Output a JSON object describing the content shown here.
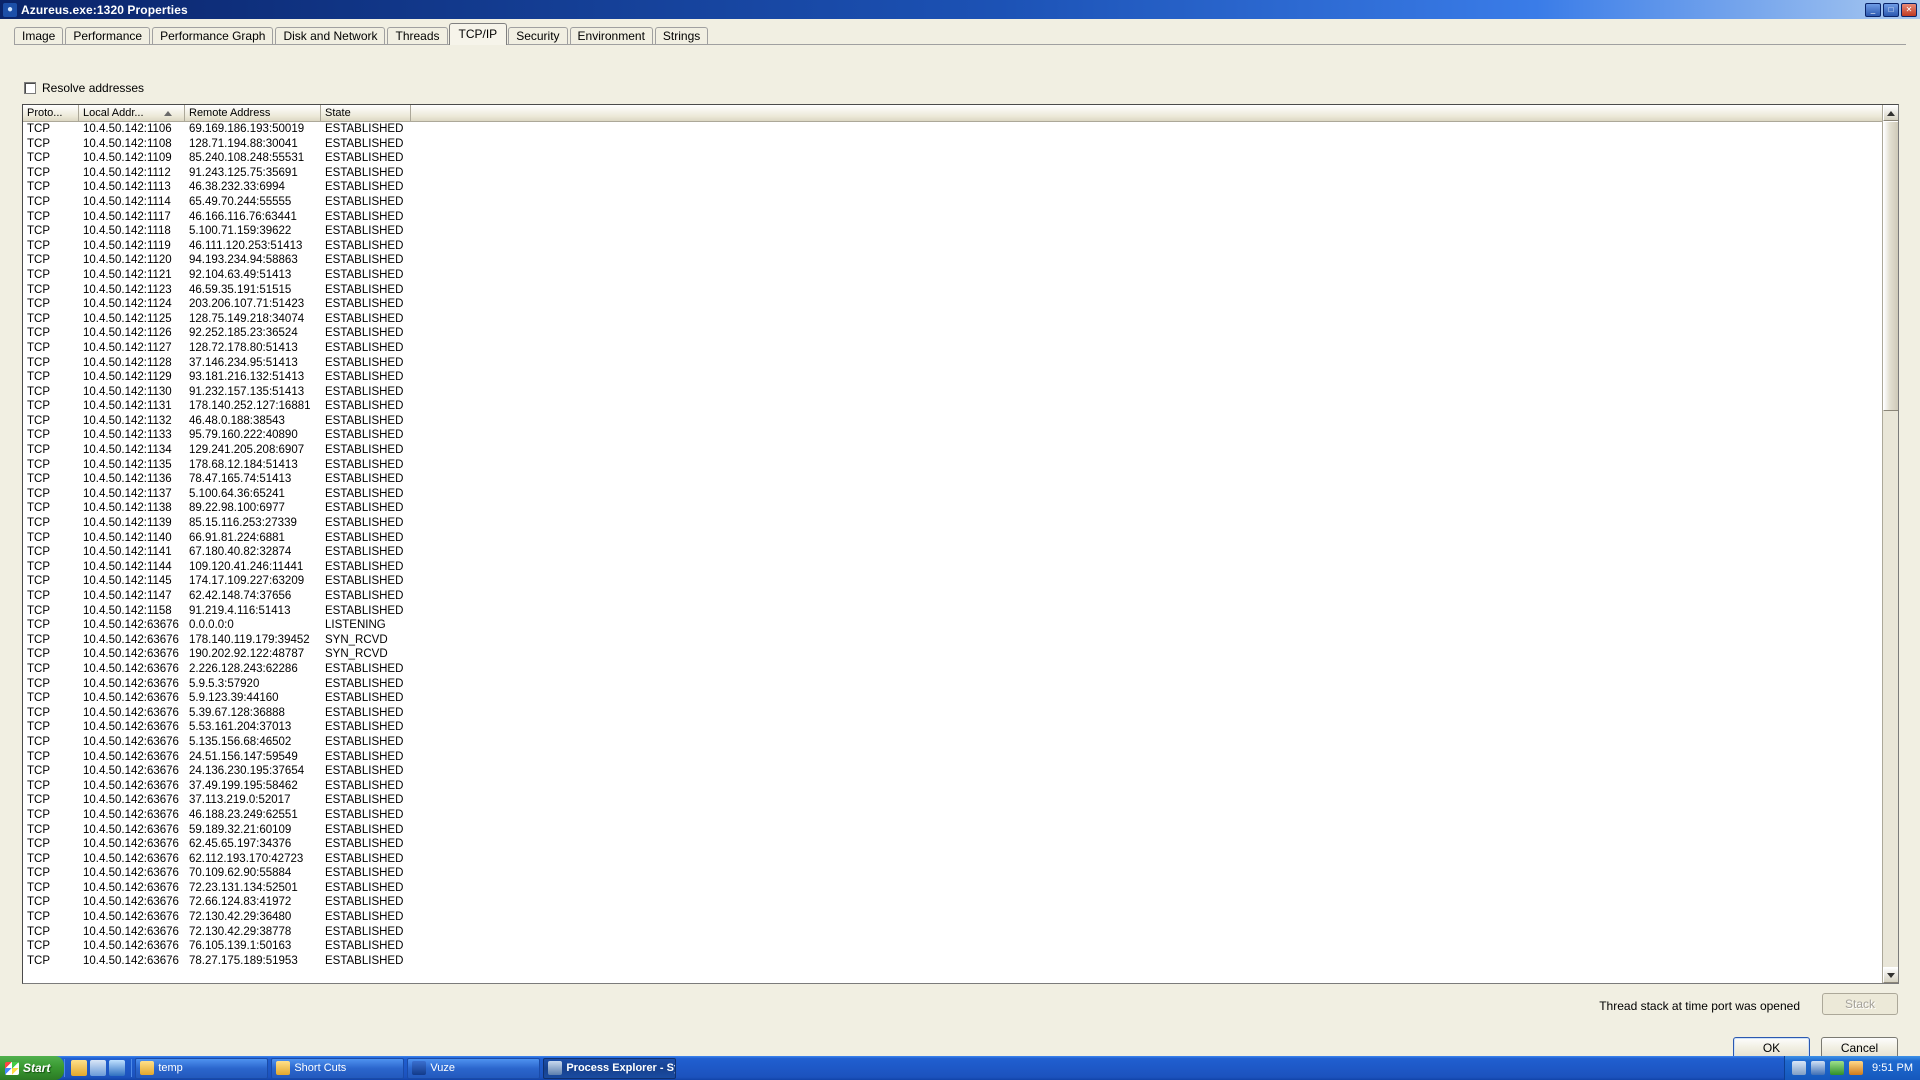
{
  "window": {
    "title": "Azureus.exe:1320 Properties",
    "icon": "azureus-icon",
    "buttons": {
      "minimize": "_",
      "maximize": "□",
      "close": "✕"
    }
  },
  "tabs": [
    {
      "label": "Image",
      "active": false
    },
    {
      "label": "Performance",
      "active": false
    },
    {
      "label": "Performance Graph",
      "active": false
    },
    {
      "label": "Disk and Network",
      "active": false
    },
    {
      "label": "Threads",
      "active": false
    },
    {
      "label": "TCP/IP",
      "active": true
    },
    {
      "label": "Security",
      "active": false
    },
    {
      "label": "Environment",
      "active": false
    },
    {
      "label": "Strings",
      "active": false
    }
  ],
  "options": {
    "resolve_addresses_label": "Resolve addresses",
    "resolve_addresses_checked": false
  },
  "table": {
    "columns": [
      {
        "label": "Proto...",
        "sorted": false
      },
      {
        "label": "Local Addr...",
        "sorted": true,
        "sort_direction": "asc"
      },
      {
        "label": "Remote Address",
        "sorted": false
      },
      {
        "label": "State",
        "sorted": false
      }
    ],
    "rows": [
      [
        "TCP",
        "10.4.50.142:1106",
        "69.169.186.193:50019",
        "ESTABLISHED"
      ],
      [
        "TCP",
        "10.4.50.142:1108",
        "128.71.194.88:30041",
        "ESTABLISHED"
      ],
      [
        "TCP",
        "10.4.50.142:1109",
        "85.240.108.248:55531",
        "ESTABLISHED"
      ],
      [
        "TCP",
        "10.4.50.142:1112",
        "91.243.125.75:35691",
        "ESTABLISHED"
      ],
      [
        "TCP",
        "10.4.50.142:1113",
        "46.38.232.33:6994",
        "ESTABLISHED"
      ],
      [
        "TCP",
        "10.4.50.142:1114",
        "65.49.70.244:55555",
        "ESTABLISHED"
      ],
      [
        "TCP",
        "10.4.50.142:1117",
        "46.166.116.76:63441",
        "ESTABLISHED"
      ],
      [
        "TCP",
        "10.4.50.142:1118",
        "5.100.71.159:39622",
        "ESTABLISHED"
      ],
      [
        "TCP",
        "10.4.50.142:1119",
        "46.111.120.253:51413",
        "ESTABLISHED"
      ],
      [
        "TCP",
        "10.4.50.142:1120",
        "94.193.234.94:58863",
        "ESTABLISHED"
      ],
      [
        "TCP",
        "10.4.50.142:1121",
        "92.104.63.49:51413",
        "ESTABLISHED"
      ],
      [
        "TCP",
        "10.4.50.142:1123",
        "46.59.35.191:51515",
        "ESTABLISHED"
      ],
      [
        "TCP",
        "10.4.50.142:1124",
        "203.206.107.71:51423",
        "ESTABLISHED"
      ],
      [
        "TCP",
        "10.4.50.142:1125",
        "128.75.149.218:34074",
        "ESTABLISHED"
      ],
      [
        "TCP",
        "10.4.50.142:1126",
        "92.252.185.23:36524",
        "ESTABLISHED"
      ],
      [
        "TCP",
        "10.4.50.142:1127",
        "128.72.178.80:51413",
        "ESTABLISHED"
      ],
      [
        "TCP",
        "10.4.50.142:1128",
        "37.146.234.95:51413",
        "ESTABLISHED"
      ],
      [
        "TCP",
        "10.4.50.142:1129",
        "93.181.216.132:51413",
        "ESTABLISHED"
      ],
      [
        "TCP",
        "10.4.50.142:1130",
        "91.232.157.135:51413",
        "ESTABLISHED"
      ],
      [
        "TCP",
        "10.4.50.142:1131",
        "178.140.252.127:16881",
        "ESTABLISHED"
      ],
      [
        "TCP",
        "10.4.50.142:1132",
        "46.48.0.188:38543",
        "ESTABLISHED"
      ],
      [
        "TCP",
        "10.4.50.142:1133",
        "95.79.160.222:40890",
        "ESTABLISHED"
      ],
      [
        "TCP",
        "10.4.50.142:1134",
        "129.241.205.208:6907",
        "ESTABLISHED"
      ],
      [
        "TCP",
        "10.4.50.142:1135",
        "178.68.12.184:51413",
        "ESTABLISHED"
      ],
      [
        "TCP",
        "10.4.50.142:1136",
        "78.47.165.74:51413",
        "ESTABLISHED"
      ],
      [
        "TCP",
        "10.4.50.142:1137",
        "5.100.64.36:65241",
        "ESTABLISHED"
      ],
      [
        "TCP",
        "10.4.50.142:1138",
        "89.22.98.100:6977",
        "ESTABLISHED"
      ],
      [
        "TCP",
        "10.4.50.142:1139",
        "85.15.116.253:27339",
        "ESTABLISHED"
      ],
      [
        "TCP",
        "10.4.50.142:1140",
        "66.91.81.224:6881",
        "ESTABLISHED"
      ],
      [
        "TCP",
        "10.4.50.142:1141",
        "67.180.40.82:32874",
        "ESTABLISHED"
      ],
      [
        "TCP",
        "10.4.50.142:1144",
        "109.120.41.246:11441",
        "ESTABLISHED"
      ],
      [
        "TCP",
        "10.4.50.142:1145",
        "174.17.109.227:63209",
        "ESTABLISHED"
      ],
      [
        "TCP",
        "10.4.50.142:1147",
        "62.42.148.74:37656",
        "ESTABLISHED"
      ],
      [
        "TCP",
        "10.4.50.142:1158",
        "91.219.4.116:51413",
        "ESTABLISHED"
      ],
      [
        "TCP",
        "10.4.50.142:63676",
        "0.0.0.0:0",
        "LISTENING"
      ],
      [
        "TCP",
        "10.4.50.142:63676",
        "178.140.119.179:39452",
        "SYN_RCVD"
      ],
      [
        "TCP",
        "10.4.50.142:63676",
        "190.202.92.122:48787",
        "SYN_RCVD"
      ],
      [
        "TCP",
        "10.4.50.142:63676",
        "2.226.128.243:62286",
        "ESTABLISHED"
      ],
      [
        "TCP",
        "10.4.50.142:63676",
        "5.9.5.3:57920",
        "ESTABLISHED"
      ],
      [
        "TCP",
        "10.4.50.142:63676",
        "5.9.123.39:44160",
        "ESTABLISHED"
      ],
      [
        "TCP",
        "10.4.50.142:63676",
        "5.39.67.128:36888",
        "ESTABLISHED"
      ],
      [
        "TCP",
        "10.4.50.142:63676",
        "5.53.161.204:37013",
        "ESTABLISHED"
      ],
      [
        "TCP",
        "10.4.50.142:63676",
        "5.135.156.68:46502",
        "ESTABLISHED"
      ],
      [
        "TCP",
        "10.4.50.142:63676",
        "24.51.156.147:59549",
        "ESTABLISHED"
      ],
      [
        "TCP",
        "10.4.50.142:63676",
        "24.136.230.195:37654",
        "ESTABLISHED"
      ],
      [
        "TCP",
        "10.4.50.142:63676",
        "37.49.199.195:58462",
        "ESTABLISHED"
      ],
      [
        "TCP",
        "10.4.50.142:63676",
        "37.113.219.0:52017",
        "ESTABLISHED"
      ],
      [
        "TCP",
        "10.4.50.142:63676",
        "46.188.23.249:62551",
        "ESTABLISHED"
      ],
      [
        "TCP",
        "10.4.50.142:63676",
        "59.189.32.21:60109",
        "ESTABLISHED"
      ],
      [
        "TCP",
        "10.4.50.142:63676",
        "62.45.65.197:34376",
        "ESTABLISHED"
      ],
      [
        "TCP",
        "10.4.50.142:63676",
        "62.112.193.170:42723",
        "ESTABLISHED"
      ],
      [
        "TCP",
        "10.4.50.142:63676",
        "70.109.62.90:55884",
        "ESTABLISHED"
      ],
      [
        "TCP",
        "10.4.50.142:63676",
        "72.23.131.134:52501",
        "ESTABLISHED"
      ],
      [
        "TCP",
        "10.4.50.142:63676",
        "72.66.124.83:41972",
        "ESTABLISHED"
      ],
      [
        "TCP",
        "10.4.50.142:63676",
        "72.130.42.29:36480",
        "ESTABLISHED"
      ],
      [
        "TCP",
        "10.4.50.142:63676",
        "72.130.42.29:38778",
        "ESTABLISHED"
      ],
      [
        "TCP",
        "10.4.50.142:63676",
        "76.105.139.1:50163",
        "ESTABLISHED"
      ],
      [
        "TCP",
        "10.4.50.142:63676",
        "78.27.175.189:51953",
        "ESTABLISHED"
      ]
    ]
  },
  "footer": {
    "note": "Thread stack at time port was opened",
    "stack_button": "Stack",
    "ok_button": "OK",
    "cancel_button": "Cancel"
  },
  "taskbar": {
    "start_label": "Start",
    "quicklaunch": [
      "folder-icon",
      "person-icon",
      "internet-explorer-icon"
    ],
    "tasks": [
      {
        "label": "temp",
        "icon": "folder-icon",
        "active": false
      },
      {
        "label": "Short Cuts",
        "icon": "folder-icon",
        "active": false
      },
      {
        "label": "Vuze",
        "icon": "vuze-icon",
        "active": false
      },
      {
        "label": "Process Explorer - Sy...",
        "icon": "process-explorer-icon",
        "active": true
      }
    ],
    "clock": "9:51 PM",
    "tray_icons": [
      "network-icon",
      "volume-icon",
      "shield-icon",
      "update-icon"
    ]
  }
}
